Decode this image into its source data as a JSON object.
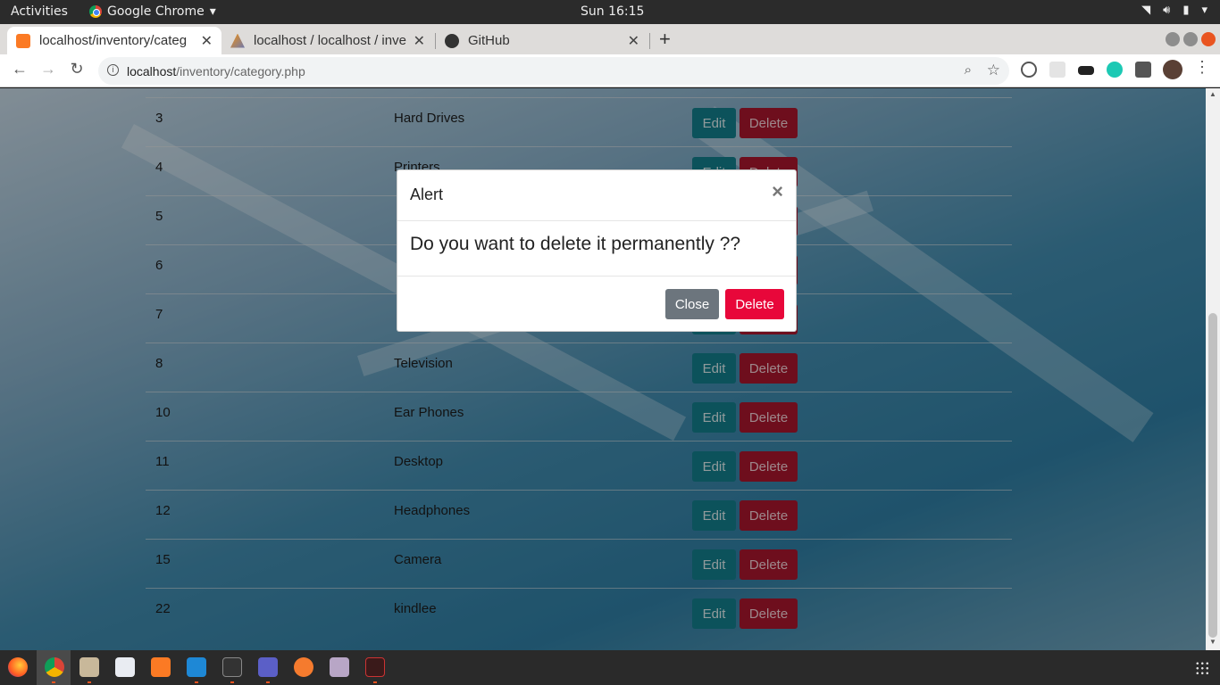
{
  "system": {
    "activities": "Activities",
    "app_name": "Google Chrome",
    "clock": "Sun 16:15"
  },
  "browser": {
    "tabs": [
      {
        "title": "localhost/inventory/categ",
        "favicon": "xampp-icon",
        "active": true
      },
      {
        "title": "localhost / localhost / inve",
        "favicon": "phpmyadmin-icon",
        "active": false
      },
      {
        "title": "GitHub",
        "favicon": "github-icon",
        "active": false
      }
    ],
    "url_host": "localhost",
    "url_path": "/inventory/category.php"
  },
  "table": {
    "rows": [
      {
        "id": "3",
        "name": "Hard Drives"
      },
      {
        "id": "4",
        "name": "Printers"
      },
      {
        "id": "5",
        "name": ""
      },
      {
        "id": "6",
        "name": ""
      },
      {
        "id": "7",
        "name": ""
      },
      {
        "id": "8",
        "name": "Television"
      },
      {
        "id": "10",
        "name": "Ear Phones"
      },
      {
        "id": "11",
        "name": "Desktop"
      },
      {
        "id": "12",
        "name": "Headphones"
      },
      {
        "id": "15",
        "name": "Camera"
      },
      {
        "id": "22",
        "name": "kindlee"
      }
    ],
    "edit_label": "Edit",
    "delete_label": "Delete"
  },
  "modal": {
    "title": "Alert",
    "close_glyph": "×",
    "message": "Do you want to delete it permanently ??",
    "close_label": "Close",
    "delete_label": "Delete"
  },
  "colors": {
    "edit": "#127a86",
    "delete": "#a3152c",
    "modal_delete": "#e8073a",
    "modal_close": "#6c757d"
  }
}
